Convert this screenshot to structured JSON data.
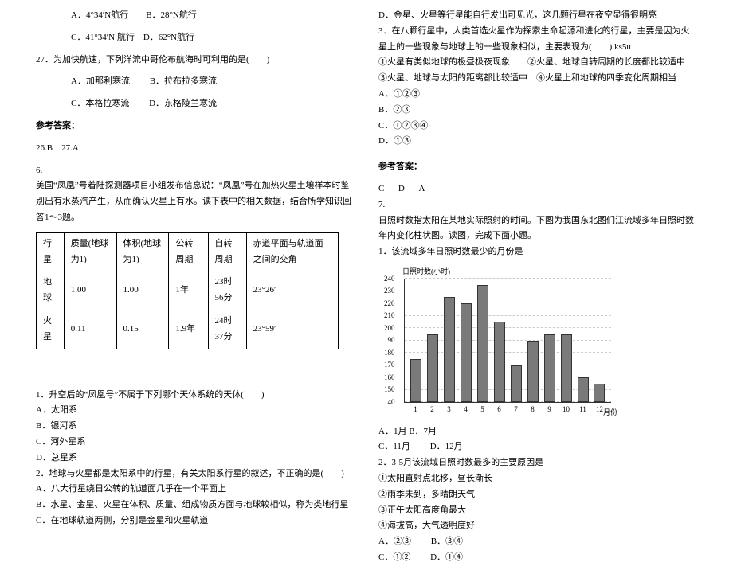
{
  "left": {
    "q26_opts_line1": "A．4°34′N航行　　B．28°N航行",
    "q26_opts_line2": "C．41°34′N 航行　D．62°N航行",
    "q27_stem": "27．为加快航速，下列洋流中哥伦布航海时可利用的是(　　)",
    "q27_a": "A．加那利寒流",
    "q27_b": "B．拉布拉多寒流",
    "q27_c": "C．本格拉寒流",
    "q27_d": "D．东格陵兰寒流",
    "ans_header": "参考答案：",
    "ans_26_27": "26.B　27.A",
    "q6_num": "6.",
    "q6_stem1": "美国“凤凰”号着陆探测器项目小组发布信息说：“凤凰”号在加热火星土壤样本时鉴别出有水蒸汽产生，从而确认火星上有水。读下表中的相关数据，结合所学知识回答1～3题。",
    "table": {
      "headers": [
        "行星",
        "质量(地球为1)",
        "体积(地球为1)",
        "公转周期",
        "自转周期",
        "赤道平面与轨道面之间的交角"
      ],
      "rows": [
        [
          "地球",
          "1.00",
          "1.00",
          "1年",
          "23时56分",
          "23°26′"
        ],
        [
          "火星",
          "0.11",
          "0.15",
          "1.9年",
          "24时37分",
          "23°59′"
        ]
      ]
    },
    "q6_1_stem": "1．升空后的“凤凰号”不属于下列哪个天体系统的天体(　　)",
    "q6_1_a": "A．太阳系",
    "q6_1_b": "B．银河系",
    "q6_1_c": "C．河外星系",
    "q6_1_d": "D．总星系",
    "q6_2_stem": "2．地球与火星都是太阳系中的行星，有关太阳系行星的叙述，不正确的是(　　)",
    "q6_2_a": "A．八大行星绕日公转的轨道面几乎在一个平面上",
    "q6_2_b": "B．水星、金星、火星在体积、质量、组成物质方面与地球较相似，称为类地行星",
    "q6_2_c": "C．在地球轨道两侧，分别是金星和火星轨道"
  },
  "right": {
    "q6_2_d": "D．金星、火星等行星能自行发出可见光，这几颗行星在夜空显得很明亮",
    "q6_3_stem": "3．在八颗行星中，人类首选火星作为探索生命起源和进化的行星，主要是因为火星上的一些现象与地球上的一些现象相似，主要表现为(　　) ks5u",
    "q6_3_c1": "①火星有类似地球的极昼极夜现象　　②火星、地球自转周期的长度都比较适中",
    "q6_3_c2": "③火星、地球与太阳的距离都比较适中　④火星上和地球的四季变化周期相当",
    "q6_3_a": "A．①②③",
    "q6_3_b": "B．②③",
    "q6_3_c": "C．①②③④",
    "q6_3_d": "D．①③",
    "ans_header": "参考答案：",
    "ans_6": "C　D　A",
    "q7_num": "7.",
    "q7_stem": "日照时数指太阳在某地实际照射的时间。下图为我国东北图们江流域多年日照时数年内变化柱状图。读图，完成下面小题。",
    "q7_1_stem": "1．该流域多年日照时数最少的月份是",
    "chart_title": "日照时数(小时)",
    "xaxis_title": "月份",
    "q7_1_a": "A．1月 B．7月",
    "q7_1_c": "C．11月",
    "q7_1_d": "D．12月",
    "q7_2_stem": "2．3-5月该流域日照时数最多的主要原因是",
    "q7_2_c1": "①太阳直射点北移，昼长渐长",
    "q7_2_c2": "②雨季未到，多晴朗天气",
    "q7_2_c3": "③正午太阳高度角最大",
    "q7_2_c4": "④海拔高，大气透明度好",
    "q7_2_a": "A．②③",
    "q7_2_b": "B．③④",
    "q7_2_c": "C．①②",
    "q7_2_d": "D．①④"
  },
  "chart_data": {
    "type": "bar",
    "title": "日照时数(小时)",
    "xlabel": "月份",
    "ylabel": "",
    "categories": [
      "1",
      "2",
      "3",
      "4",
      "5",
      "6",
      "7",
      "8",
      "9",
      "10",
      "11",
      "12"
    ],
    "values": [
      175,
      195,
      225,
      220,
      235,
      205,
      170,
      190,
      195,
      195,
      160,
      155
    ],
    "ylim": [
      140,
      240
    ],
    "yticks": [
      140,
      150,
      160,
      170,
      180,
      190,
      200,
      210,
      220,
      230,
      240
    ]
  }
}
